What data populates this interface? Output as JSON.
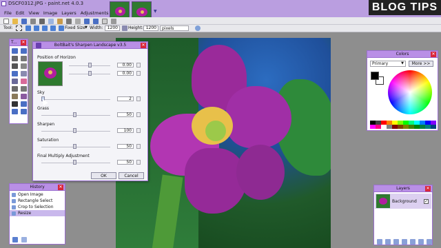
{
  "window": {
    "title": "DSCF0312.JPG - paint.net 4.0.3"
  },
  "menu": [
    "File",
    "Edit",
    "View",
    "Image",
    "Layers",
    "Adjustments",
    "Effects"
  ],
  "toolbar2": {
    "tool_label": "Tool:",
    "fixed_size": "Fixed Size",
    "width_label": "Width:",
    "width_value": "1200",
    "height_label": "Height:",
    "height_value": "1200",
    "unit": "pixels"
  },
  "watermark": {
    "text": "BLOG TIPS"
  },
  "tools_panel": {
    "title": "T..."
  },
  "dialog": {
    "title": "BoltBait's Sharpen Landscape v3.5",
    "horizon_label": "Position of Horizon",
    "horizon_x": "0.00",
    "horizon_y": "0.00",
    "sky_label": "Sky",
    "sky_value": "2",
    "grass_label": "Grass",
    "grass_value": "50",
    "sharpen_label": "Sharpen",
    "sharpen_value": "100",
    "saturation_label": "Saturation",
    "saturation_value": "50",
    "multiply_label": "Final Multiply Adjustment",
    "multiply_value": "50",
    "ok": "OK",
    "cancel": "Cancel"
  },
  "history": {
    "title": "History",
    "items": [
      "Open Image",
      "Rectangle Select",
      "Crop to Selection",
      "Resize"
    ]
  },
  "colors": {
    "title": "Colors",
    "mode": "Primary",
    "more": "More >>",
    "primary": "#000000",
    "secondary": "#ffffff"
  },
  "layers": {
    "title": "Layers",
    "items": [
      "Background"
    ]
  }
}
